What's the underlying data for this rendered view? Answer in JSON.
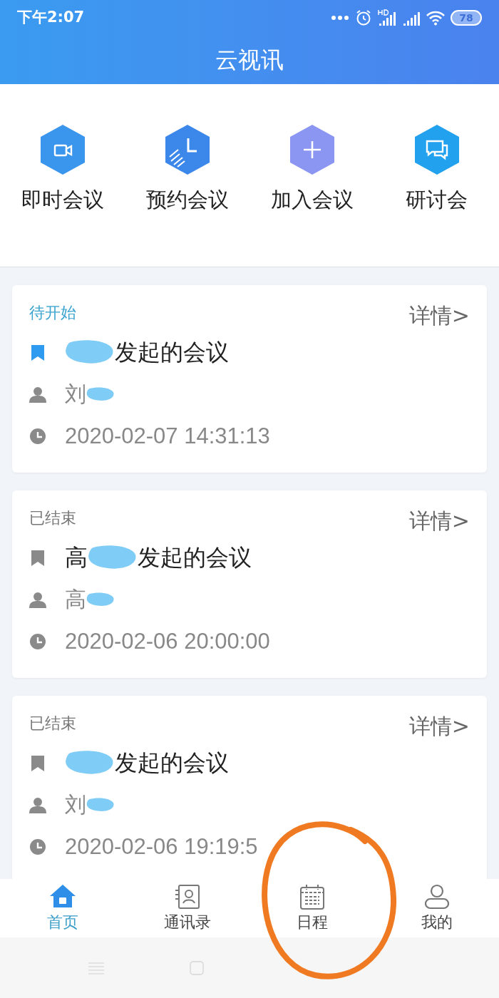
{
  "status_bar": {
    "time": "下午2:07",
    "battery": "78"
  },
  "title": "云视讯",
  "quick_actions": [
    {
      "label": "即时会议",
      "kind": "video",
      "color": "#3a95ec"
    },
    {
      "label": "预约会议",
      "kind": "schedule",
      "color": "#3b87ea"
    },
    {
      "label": "加入会议",
      "kind": "join",
      "color": "#8a96f2"
    },
    {
      "label": "研讨会",
      "kind": "seminar",
      "color": "#22a1ef"
    }
  ],
  "meetings": [
    {
      "status": "待开始",
      "kind": "upcoming",
      "detail": "详情>",
      "title": "发起的会议",
      "host": "刘",
      "time": "2020-02-07 14:31:13"
    },
    {
      "status": "已结束",
      "kind": "ended",
      "detail": "详情>",
      "title_prefix": "高",
      "title": "发起的会议",
      "host": "高",
      "time": "2020-02-06 20:00:00"
    },
    {
      "status": "已结束",
      "kind": "ended",
      "detail": "详情>",
      "title": "发起的会议",
      "host": "刘",
      "time": "2020-02-06 19:19:5"
    }
  ],
  "tabs": [
    {
      "label": "首页",
      "kind": "home",
      "selected": true
    },
    {
      "label": "通讯录",
      "kind": "contacts",
      "selected": false
    },
    {
      "label": "日程",
      "kind": "calendar",
      "selected": false
    },
    {
      "label": "我的",
      "kind": "profile",
      "selected": false
    }
  ],
  "annotation_circle": true
}
